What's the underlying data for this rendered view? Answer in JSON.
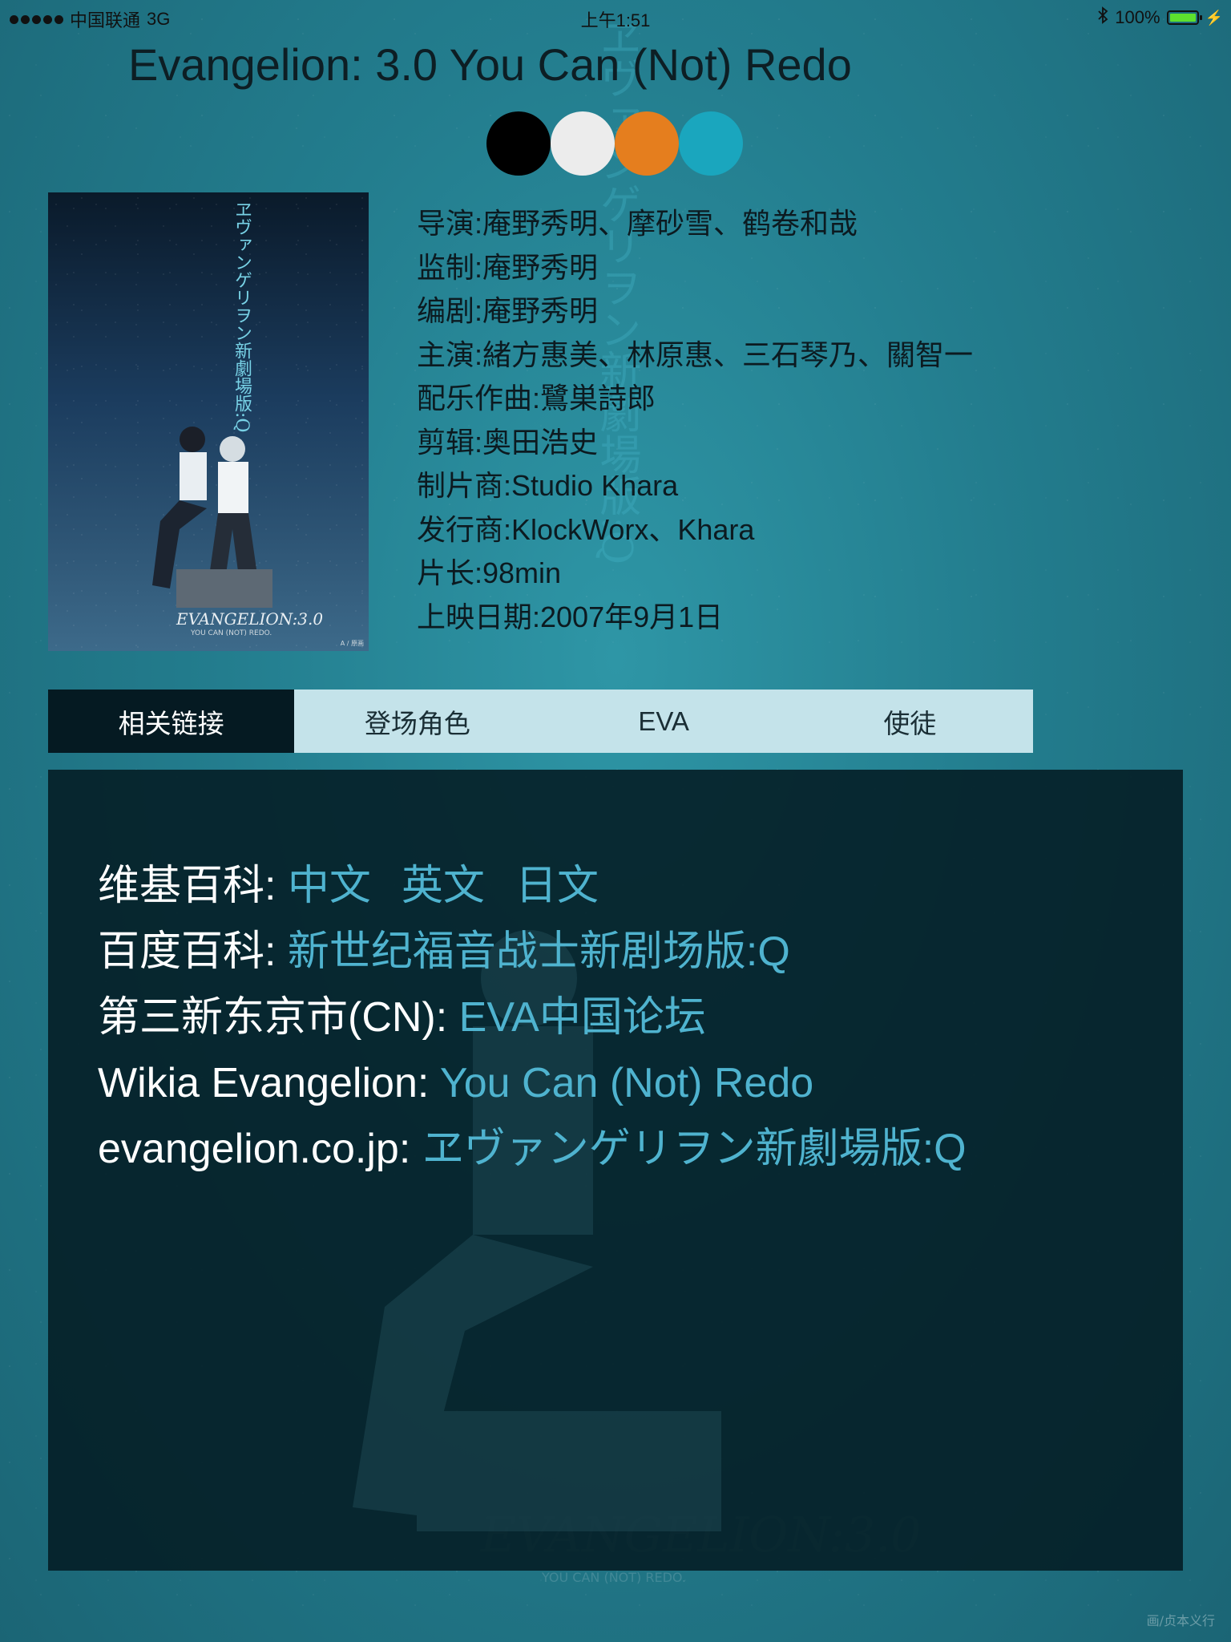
{
  "status_bar": {
    "carrier": "中国联通",
    "network": "3G",
    "time": "上午1:51",
    "battery": "100%",
    "battery_level": 1.0
  },
  "movie": {
    "title": "Evangelion: 3.0 You Can (Not) Redo",
    "palette": [
      "#000000",
      "#ececec",
      "#e57e1e",
      "#1aa6be"
    ],
    "poster": {
      "vertical_title": "ヱヴァンゲリヲン新劇場版:Q",
      "logo": "EVANGELION:3.0",
      "sub": "YOU CAN (NOT) REDO.",
      "tiny": "A / 原画"
    },
    "info": [
      "导演:庵野秀明、摩砂雪、鹤卷和哉",
      "监制:庵野秀明",
      "编剧:庵野秀明",
      "主演:緒方惠美、林原惠、三石琴乃、關智一",
      "配乐作曲:鷺巣詩郎",
      "剪辑:奥田浩史",
      "制片商:Studio Khara",
      "发行商:KlockWorx、Khara",
      "片长:98min",
      "上映日期:2007年9月1日"
    ]
  },
  "tabs": [
    {
      "label": "相关链接",
      "active": true
    },
    {
      "label": "登场角色",
      "active": false
    },
    {
      "label": "EVA",
      "active": false
    },
    {
      "label": "使徒",
      "active": false
    }
  ],
  "links": [
    {
      "label": "维基百科: ",
      "items": [
        "中文",
        "英文",
        "日文"
      ]
    },
    {
      "label": "百度百科: ",
      "items": [
        "新世纪福音战士新剧场版:Q"
      ]
    },
    {
      "label": "第三新东京市(CN): ",
      "items": [
        "EVA中国论坛"
      ]
    },
    {
      "label": "Wikia Evangelion: ",
      "items": [
        "You Can (Not) Redo"
      ]
    },
    {
      "label": "evangelion.co.jp: ",
      "items": [
        "ヱヴァンゲリヲン新劇場版:Q"
      ]
    }
  ],
  "background": {
    "vertical_text": "ヱヴァンゲリヲン新劇場版:Q",
    "logo": "EVANGELION:3.0",
    "sub": "YOU CAN (NOT) REDO.",
    "credit": "画/贞本义行"
  }
}
